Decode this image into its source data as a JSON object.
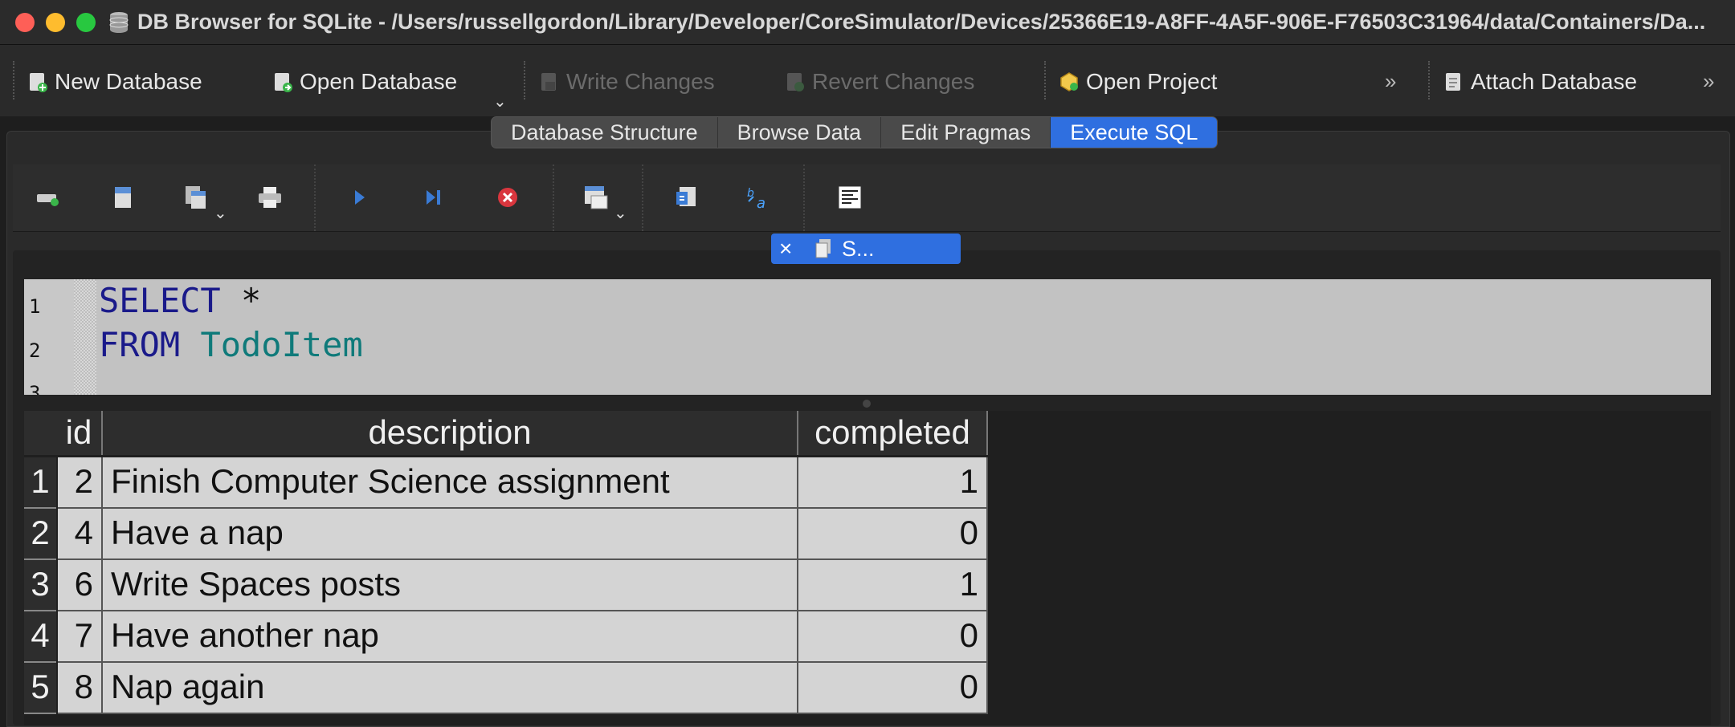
{
  "window": {
    "title": "DB Browser for SQLite - /Users/russellgordon/Library/Developer/CoreSimulator/Devices/25366E19-A8FF-4A5F-906E-F76503C31964/data/Containers/Da..."
  },
  "toolbar": {
    "new_database": "New Database",
    "open_database": "Open Database",
    "write_changes": "Write Changes",
    "revert_changes": "Revert Changes",
    "open_project": "Open Project",
    "attach_database": "Attach Database",
    "overflow": "»"
  },
  "tabs": [
    {
      "label": "Database Structure",
      "active": false
    },
    {
      "label": "Browse Data",
      "active": false
    },
    {
      "label": "Edit Pragmas",
      "active": false
    },
    {
      "label": "Execute SQL",
      "active": true
    }
  ],
  "sql_tab": {
    "label": "S...",
    "close": "×"
  },
  "editor": {
    "line_numbers": [
      "1",
      "2",
      "3"
    ],
    "line1_kw": "SELECT",
    "line1_rest": " *",
    "line2_kw": "FROM",
    "line2_table": "TodoItem"
  },
  "results": {
    "columns": [
      "id",
      "description",
      "completed"
    ],
    "row_numbers": [
      "1",
      "2",
      "3",
      "4",
      "5"
    ],
    "rows": [
      {
        "id": "2",
        "description": "Finish Computer Science assignment",
        "completed": "1"
      },
      {
        "id": "4",
        "description": "Have a nap",
        "completed": "0"
      },
      {
        "id": "6",
        "description": "Write Spaces posts",
        "completed": "1"
      },
      {
        "id": "7",
        "description": "Have another nap",
        "completed": "0"
      },
      {
        "id": "8",
        "description": "Nap again",
        "completed": "0"
      }
    ]
  },
  "colors": {
    "accent": "#2f6fe0",
    "sql_keyword": "#1a1a8a",
    "sql_identifier": "#0f7a7a"
  }
}
